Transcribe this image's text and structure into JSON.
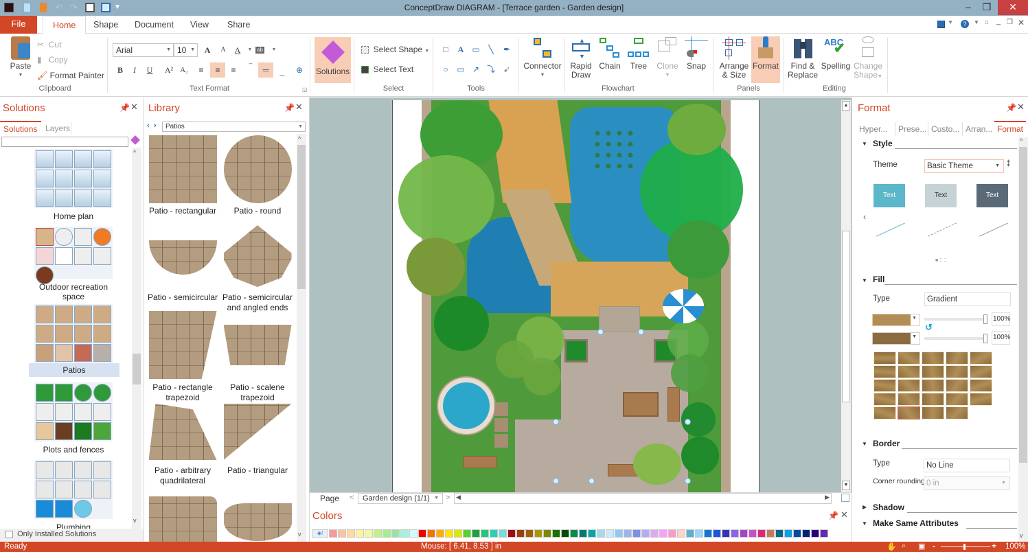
{
  "window": {
    "title": "ConceptDraw DIAGRAM - [Terrace garden - Garden design]",
    "controls": {
      "minimize": "–",
      "restore": "❐",
      "close": "✕"
    }
  },
  "quick_access": [
    "app-icon",
    "new-icon",
    "open-icon",
    "undo-icon",
    "redo-icon",
    "save-icon",
    "print-preview-icon",
    "customize-icon"
  ],
  "ribbon_tabs": {
    "file": "File",
    "tabs": [
      "Home",
      "Shape",
      "Document",
      "View",
      "Share"
    ],
    "active": "Home"
  },
  "ribbon": {
    "clipboard": {
      "paste": "Paste",
      "cut": "Cut",
      "copy": "Copy",
      "format_painter": "Format Painter",
      "label": "Clipboard"
    },
    "text_format": {
      "font": "Arial",
      "size": "10",
      "label": "Text Format",
      "bold": "B",
      "italic": "I",
      "underline": "U"
    },
    "solutions": {
      "label": "Solutions"
    },
    "select": {
      "select_shape": "Select Shape",
      "select_text": "Select Text",
      "label": "Select"
    },
    "tools": {
      "label": "Tools"
    },
    "flowchart": {
      "connector": "Connector",
      "rapid_draw_1": "Rapid",
      "rapid_draw_2": "Draw",
      "chain": "Chain",
      "tree": "Tree",
      "clone": "Clone",
      "snap": "Snap",
      "label": "Flowchart"
    },
    "panels": {
      "arrange_1": "Arrange",
      "arrange_2": "& Size",
      "format": "Format",
      "label": "Panels"
    },
    "editing": {
      "find_1": "Find &",
      "find_2": "Replace",
      "spelling": "Spelling",
      "change_1": "Change",
      "change_2": "Shape",
      "label": "Editing"
    }
  },
  "solutions_panel": {
    "title": "Solutions",
    "tabs": [
      "Solutions",
      "Layers"
    ],
    "search_value": "",
    "groups": [
      {
        "label": "Home plan",
        "selected": false
      },
      {
        "label": "Outdoor recreation space",
        "selected": false
      },
      {
        "label": "Patios",
        "selected": true
      },
      {
        "label": "Plots and fences",
        "selected": false
      },
      {
        "label": "Plumbing",
        "selected": false
      }
    ],
    "only_installed": "Only Installed Solutions",
    "only_installed_checked": false
  },
  "library_panel": {
    "title": "Library",
    "selected_library": "Patios",
    "items": [
      {
        "label": "Patio - rectangular"
      },
      {
        "label": "Patio - round"
      },
      {
        "label": "Patio - semicircular"
      },
      {
        "label": "Patio - semicircular and angled ends"
      },
      {
        "label": "Patio - rectangle trapezoid"
      },
      {
        "label": "Patio - scalene trapezoid"
      },
      {
        "label": "Patio - arbitrary quadrilateral"
      },
      {
        "label": "Patio - triangular"
      }
    ]
  },
  "canvas": {
    "page_label": "Page",
    "page_selector": "Garden design (1/1)"
  },
  "format_panel": {
    "title": "Format",
    "tabs": [
      "Hyper...",
      "Prese...",
      "Custo...",
      "Arran...",
      "Format"
    ],
    "active_tab": "Format",
    "style": {
      "section": "Style",
      "theme_label": "Theme",
      "theme_value": "Basic Theme",
      "swatches": [
        {
          "text": "Text",
          "bg": "#5bb7c9",
          "fg": "#ffffff"
        },
        {
          "text": "Text",
          "bg": "#c5d3d6",
          "fg": "#333333"
        },
        {
          "text": "Text",
          "bg": "#5b6a77",
          "fg": "#ffffff"
        }
      ]
    },
    "fill": {
      "section": "Fill",
      "type_label": "Type",
      "type_value": "Gradient",
      "color1": "#b08e55",
      "color2": "#8c6c3f",
      "opacity1": "100%",
      "opacity2": "100%"
    },
    "border": {
      "section": "Border",
      "type_label": "Type",
      "type_value": "No Line",
      "corner_label": "Corner rounding",
      "corner_value": "0 in"
    },
    "shadow": {
      "section": "Shadow"
    },
    "make_same": {
      "section": "Make Same Attributes"
    }
  },
  "colors_panel": {
    "title": "Colors",
    "palette": [
      "#f49a9a",
      "#fcc39e",
      "#fddba0",
      "#fdf39e",
      "#eefca0",
      "#c3f283",
      "#a3ee8e",
      "#94e5a7",
      "#9ff5df",
      "#d3fbfd",
      "#ee0000",
      "#f37500",
      "#ffae00",
      "#ffe500",
      "#d8ec00",
      "#57d22c",
      "#1ba43a",
      "#28c67b",
      "#26d3b5",
      "#79d9dc",
      "#9b0c15",
      "#9b3f0c",
      "#a06200",
      "#a79900",
      "#7b8a00",
      "#1a7200",
      "#004f0c",
      "#008c4b",
      "#007e72",
      "#00a9a9",
      "#a5d9ec",
      "#cbe9fb",
      "#8ecaf8",
      "#98b6e9",
      "#7e91e0",
      "#b1aaf8",
      "#ddaaf2",
      "#fc9ef8",
      "#fa9bc7",
      "#fdd3c3",
      "#5ab1d0",
      "#96d8fb",
      "#0e79d2",
      "#1f55da",
      "#3434b8",
      "#8b64e8",
      "#a745c8",
      "#c74fc9",
      "#e0247b",
      "#c47a5b",
      "#006888",
      "#0da1e6",
      "#004ca0",
      "#002277",
      "#28007c",
      "#5f2ab0"
    ]
  },
  "statusbar": {
    "status": "Ready",
    "mouse": "Mouse: [ 6.41, 8.53 ] in",
    "zoom": "100%"
  }
}
